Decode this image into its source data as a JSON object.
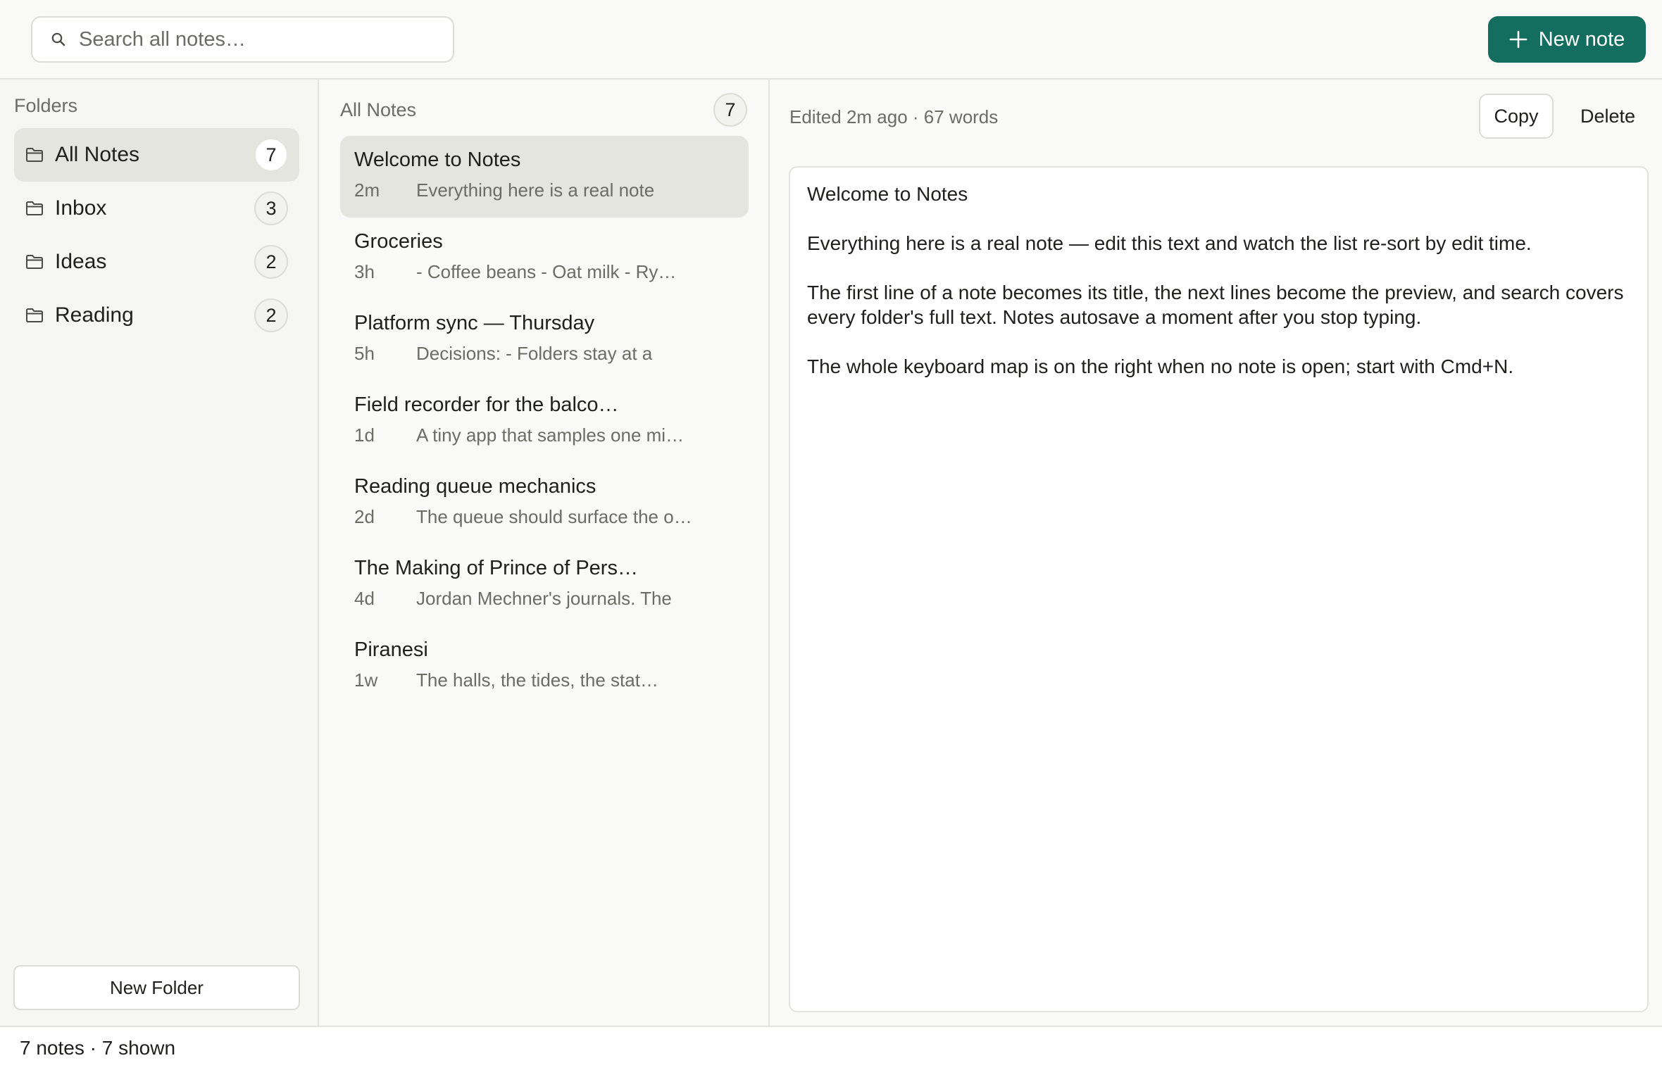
{
  "search": {
    "placeholder": "Search all notes…"
  },
  "toolbar": {
    "new_note_label": "New note"
  },
  "sidebar": {
    "heading": "Folders",
    "folders": [
      {
        "label": "All Notes",
        "count": "7",
        "active": true
      },
      {
        "label": "Inbox",
        "count": "3"
      },
      {
        "label": "Ideas",
        "count": "2"
      },
      {
        "label": "Reading",
        "count": "2"
      }
    ],
    "new_folder_label": "New Folder"
  },
  "notes": {
    "heading": "All Notes",
    "count": "7",
    "items": [
      {
        "title": "Welcome to Notes",
        "time": "2m",
        "preview": "Everything here is a real note",
        "active": true
      },
      {
        "title": "Groceries",
        "time": "3h",
        "preview": "- Coffee beans - Oat milk - Ry…"
      },
      {
        "title": "Platform sync — Thursday",
        "time": "5h",
        "preview": "Decisions: - Folders stay at a"
      },
      {
        "title": "Field recorder for the balco…",
        "time": "1d",
        "preview": "A tiny app that samples one mi…"
      },
      {
        "title": "Reading queue mechanics",
        "time": "2d",
        "preview": "The queue should surface the o…"
      },
      {
        "title": "The Making of Prince of Pers…",
        "time": "4d",
        "preview": "Jordan Mechner's journals. The"
      },
      {
        "title": "Piranesi",
        "time": "1w",
        "preview": "The halls, the tides, the stat…"
      }
    ]
  },
  "editor": {
    "meta": "Edited 2m ago · 67 words",
    "copy_label": "Copy",
    "delete_label": "Delete",
    "paragraphs": [
      "Welcome to Notes",
      "Everything here is a real note — edit this text and watch the list re-sort by edit time.",
      "The first line of a note becomes its title, the next lines become the preview, and search covers every folder's full text. Notes autosave a moment after you stop typing.",
      "The whole keyboard map is on the right when no note is open; start with Cmd+N."
    ]
  },
  "status": {
    "text": "7 notes · 7 shown"
  },
  "colors": {
    "accent": "#146e60",
    "selected_row": "#e5e5e0",
    "border": "#e2e2de"
  },
  "icons": {
    "search": "search-icon",
    "plus": "plus-icon",
    "folder": "folder-icon"
  }
}
